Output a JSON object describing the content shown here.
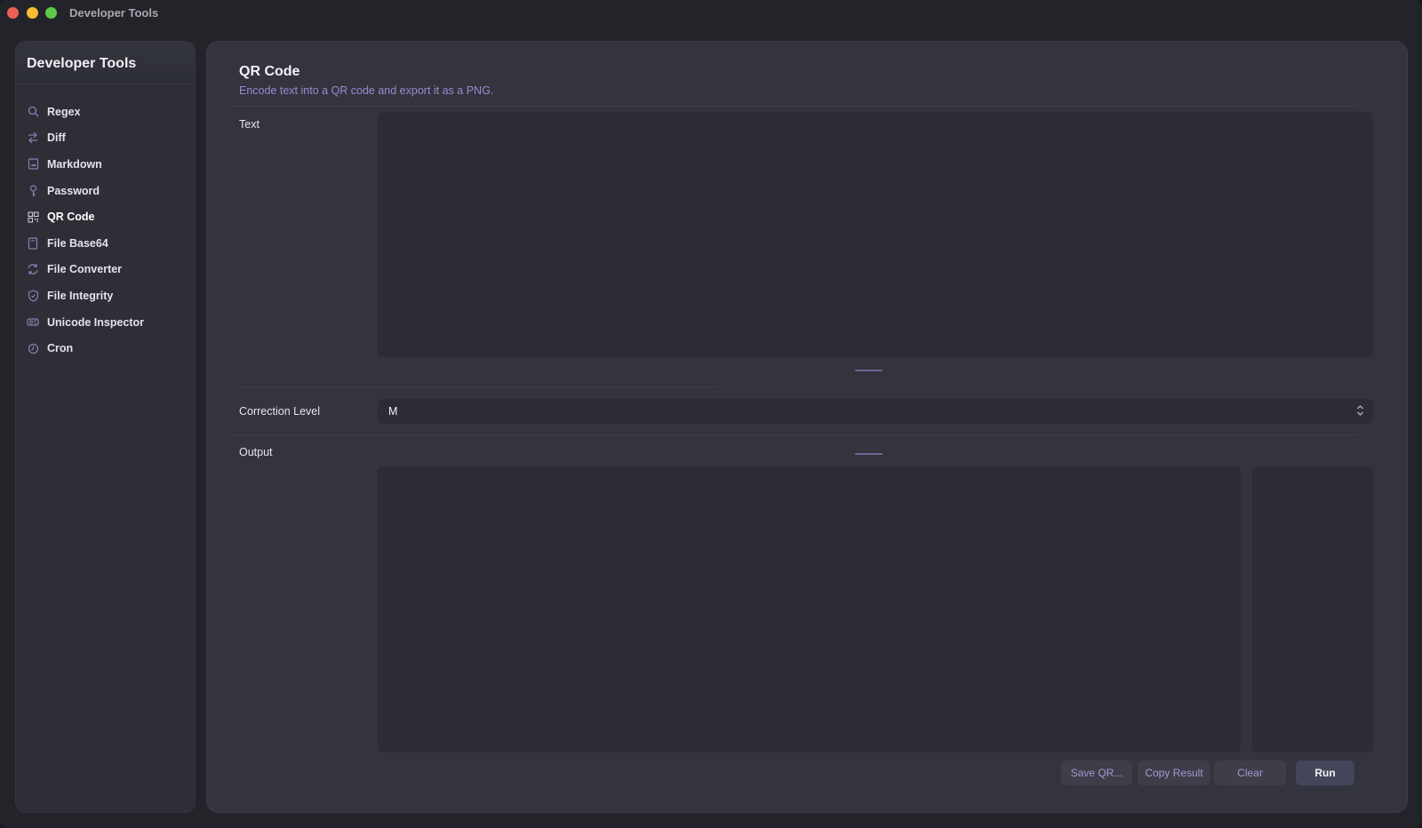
{
  "window": {
    "title": "Developer Tools"
  },
  "sidebar": {
    "title": "Developer Tools",
    "items": [
      {
        "label": "Regex",
        "icon": "search-icon"
      },
      {
        "label": "Diff",
        "icon": "swap-arrows-icon"
      },
      {
        "label": "Markdown",
        "icon": "document-image-icon"
      },
      {
        "label": "Password",
        "icon": "key-icon"
      },
      {
        "label": "QR Code",
        "icon": "qr-code-icon",
        "active": true
      },
      {
        "label": "File Base64",
        "icon": "file-icon"
      },
      {
        "label": "File Converter",
        "icon": "refresh-icon"
      },
      {
        "label": "File Integrity",
        "icon": "shield-icon"
      },
      {
        "label": "Unicode Inspector",
        "icon": "character-icon"
      },
      {
        "label": "Cron",
        "icon": "clock-icon"
      }
    ]
  },
  "main": {
    "title": "QR Code",
    "subtitle": "Encode text into a QR code and export it as a PNG.",
    "text_label": "Text",
    "text_value": "",
    "correction_label": "Correction Level",
    "correction_value": "M",
    "output_label": "Output",
    "buttons": {
      "save": "Save QR...",
      "copy": "Copy Result",
      "clear": "Clear",
      "run": "Run"
    }
  },
  "colors": {
    "accent": "#9d88d3",
    "background": "#232429",
    "panel": "#33343d",
    "input": "#2b2c34"
  }
}
